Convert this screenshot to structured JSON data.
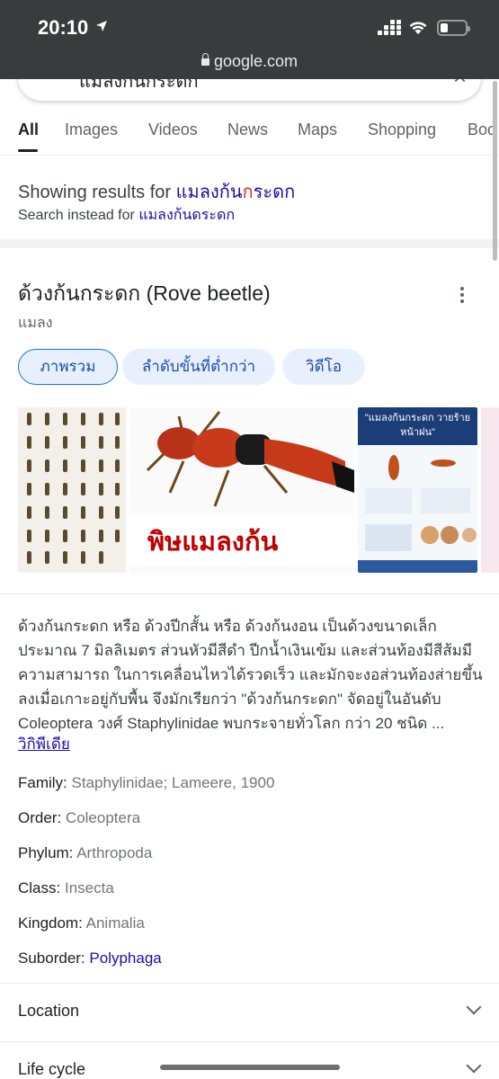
{
  "status": {
    "time": "20:10"
  },
  "browser": {
    "url": "google.com"
  },
  "search": {
    "query": "แมลงก้นกระดก"
  },
  "tabs": [
    "All",
    "Images",
    "Videos",
    "News",
    "Maps",
    "Shopping",
    "Boo"
  ],
  "spell": {
    "showing_prefix": "Showing results for",
    "corrected_a": "แมลงก้น",
    "corrected_b": "ก",
    "corrected_c": "ระดก",
    "instead_prefix": "Search instead for",
    "original": "แมลงก้นดระดก"
  },
  "panel": {
    "title": "ด้วงก้นกระดก (Rove beetle)",
    "subtitle": "แมลง",
    "chips": [
      "ภาพรวม",
      "ลำดับขั้นที่ต่ำกว่า",
      "วิดีโอ"
    ],
    "image2_caption": "พิษแมลงก้นกระดก",
    "image3_caption": "\"แมลงก้นกระดก วายร้ายหน้าฝน\"",
    "description": "ด้วงก้นกระดก หรือ ด้วงปีกสั้น หรือ ด้วงก้นงอน เป็นด้วงขนาดเล็กประมาณ 7 มิลลิเมตร ส่วนหัวมีสีดำ ปีกน้ำเงินเข้ม และส่วนท้องมีสีส้มมีความสามารถ ในการเคลื่อนไหวได้รวดเร็ว และมักจะงอส่วนท้องส่ายขึ้นลงเมื่อเกาะอยู่กับพื้น จึงมักเรียกว่า \"ด้วงก้นกระดก\" จัดอยู่ในอันดับ Coleoptera วงศ์ Staphylinidae พบกระจายทั่วโลก กว่า 20 ชนิด ...",
    "source": "วิกิพีเดีย",
    "facts": [
      {
        "label": "Family:",
        "value": "Staphylinidae; Lameere, 1900"
      },
      {
        "label": "Order:",
        "value": "Coleoptera"
      },
      {
        "label": "Phylum:",
        "value": "Arthropoda"
      },
      {
        "label": "Class:",
        "value": "Insecta"
      },
      {
        "label": "Kingdom:",
        "value": "Animalia"
      },
      {
        "label": "Suborder:",
        "value": "Polyphaga"
      }
    ],
    "sections": [
      "Location",
      "Life cycle"
    ]
  }
}
